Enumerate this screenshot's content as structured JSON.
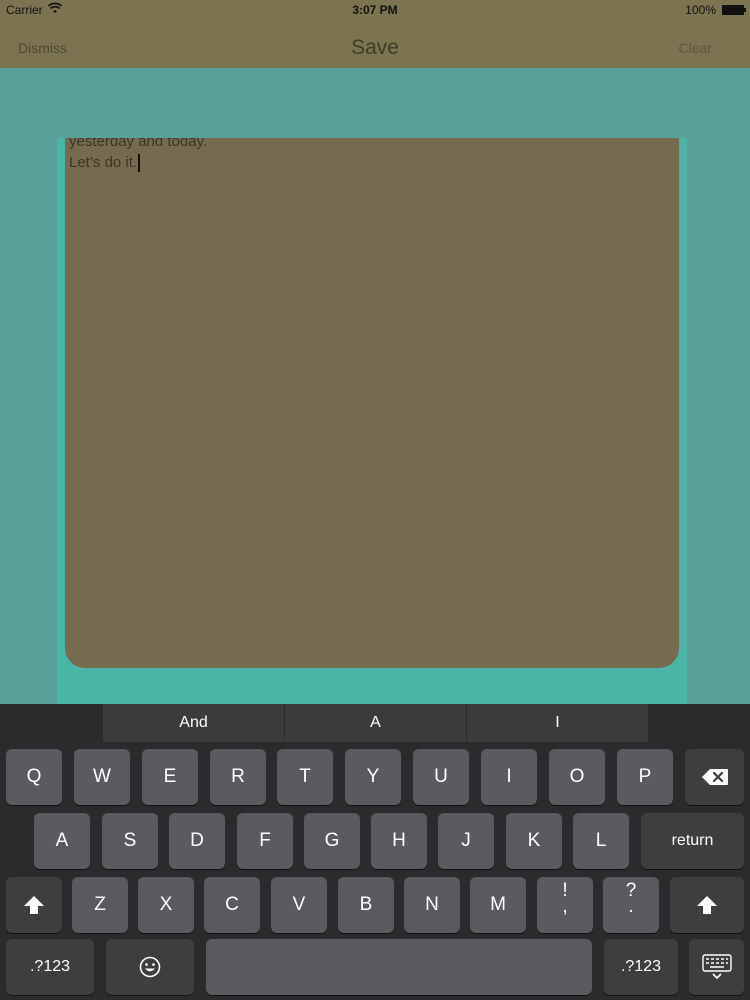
{
  "status": {
    "carrier": "Carrier",
    "time": "3:07 PM",
    "battery": "100%"
  },
  "nav": {
    "left": "Dismiss",
    "title": "Save",
    "right": "Clear"
  },
  "note": {
    "line1": "yesterday and today.",
    "line2": "Let’s do it."
  },
  "suggestions": [
    "And",
    "A",
    "I"
  ],
  "keys": {
    "row1": [
      "Q",
      "W",
      "E",
      "R",
      "T",
      "Y",
      "U",
      "I",
      "O",
      "P"
    ],
    "row2": [
      "A",
      "S",
      "D",
      "F",
      "G",
      "H",
      "J",
      "K",
      "L"
    ],
    "row3": [
      "Z",
      "X",
      "C",
      "V",
      "B",
      "N",
      "M"
    ],
    "return": "return",
    "numbers": ".?123",
    "numbers_right": ".?123",
    "exclaim": "!",
    "comma": ",",
    "question": "?",
    "period": "."
  },
  "icons": {
    "delete": "backspace-icon",
    "shift": "shift-icon",
    "emoji": "emoji-icon",
    "dismiss": "keyboard-dismiss-icon",
    "wifi": "wifi-icon",
    "battery": "battery-icon"
  }
}
